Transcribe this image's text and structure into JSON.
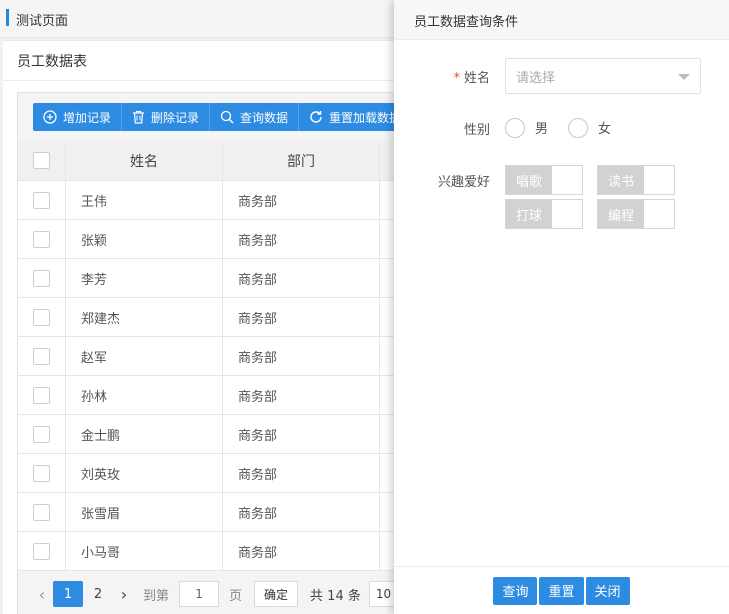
{
  "page_tab": {
    "title": "测试页面"
  },
  "panel": {
    "title": "员工数据表"
  },
  "toolbar": {
    "add": "增加记录",
    "delete": "删除记录",
    "query": "查询数据",
    "reload": "重置加载数据"
  },
  "table": {
    "columns": [
      "姓名",
      "部门"
    ],
    "rows": [
      {
        "name": "王伟",
        "dept": "商务部"
      },
      {
        "name": "张颖",
        "dept": "商务部"
      },
      {
        "name": "李芳",
        "dept": "商务部"
      },
      {
        "name": "郑建杰",
        "dept": "商务部"
      },
      {
        "name": "赵军",
        "dept": "商务部"
      },
      {
        "name": "孙林",
        "dept": "商务部"
      },
      {
        "name": "金士鹏",
        "dept": "商务部"
      },
      {
        "name": "刘英玫",
        "dept": "商务部"
      },
      {
        "name": "张雪眉",
        "dept": "商务部"
      },
      {
        "name": "小马哥",
        "dept": "商务部"
      }
    ]
  },
  "pager": {
    "pages": [
      "1",
      "2"
    ],
    "current": "1",
    "goto_label": "到第",
    "goto_value": "1",
    "page_label": "页",
    "confirm": "确定",
    "total": "共 14 条",
    "page_size": "10"
  },
  "drawer": {
    "title": "员工数据查询条件",
    "name_label": "姓名",
    "name_placeholder": "请选择",
    "gender_label": "性别",
    "genders": [
      "男",
      "女"
    ],
    "hobby_label": "兴趣爱好",
    "hobbies": [
      "唱歌",
      "读书",
      "打球",
      "编程"
    ],
    "buttons": {
      "query": "查询",
      "reset": "重置",
      "close": "关闭"
    }
  },
  "colors": {
    "primary": "#2d8ce2",
    "required": "#e74c3c"
  }
}
